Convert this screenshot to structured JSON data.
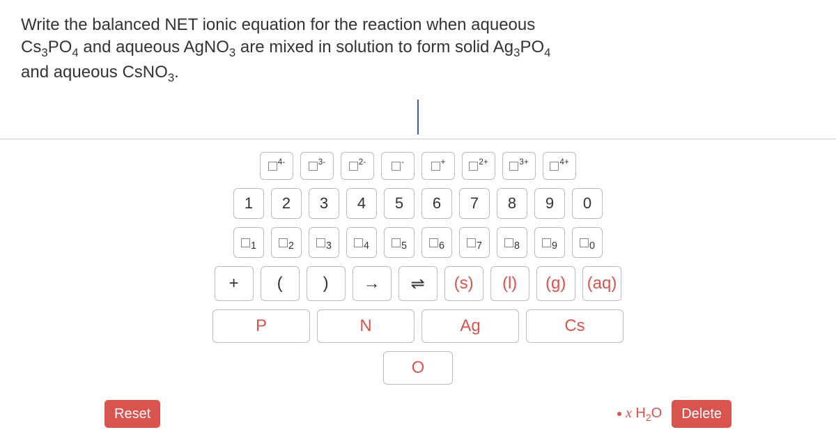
{
  "prompt": {
    "line1_pre": "Write the balanced NET ionic equation for the reaction when aqueous",
    "cs3po4": "Cs₃PO₄",
    "line2_mid1": " and aqueous ",
    "agno3": "AgNO₃",
    "line2_mid2": " are mixed in solution to form solid ",
    "ag3po4": "Ag₃PO₄",
    "line3_pre": "and aqueous ",
    "csno3": "CsNO₃",
    "period": "."
  },
  "charges": [
    "4-",
    "3-",
    "2-",
    "-",
    "+",
    "2+",
    "3+",
    "4+"
  ],
  "digits": [
    "1",
    "2",
    "3",
    "4",
    "5",
    "6",
    "7",
    "8",
    "9",
    "0"
  ],
  "subscripts": [
    "1",
    "2",
    "3",
    "4",
    "5",
    "6",
    "7",
    "8",
    "9",
    "0"
  ],
  "ops": {
    "plus": "+",
    "lparen": "(",
    "rparen": ")",
    "arrow": "→",
    "dblarrow": "⇌",
    "s": "(s)",
    "l": "(l)",
    "g": "(g)",
    "aq": "(aq)"
  },
  "elements": {
    "P": "P",
    "N": "N",
    "Ag": "Ag",
    "Cs": "Cs",
    "O": "O"
  },
  "buttons": {
    "reset": "Reset",
    "delete": "Delete"
  },
  "hint": {
    "x": "x",
    "h2o": "H₂O"
  }
}
